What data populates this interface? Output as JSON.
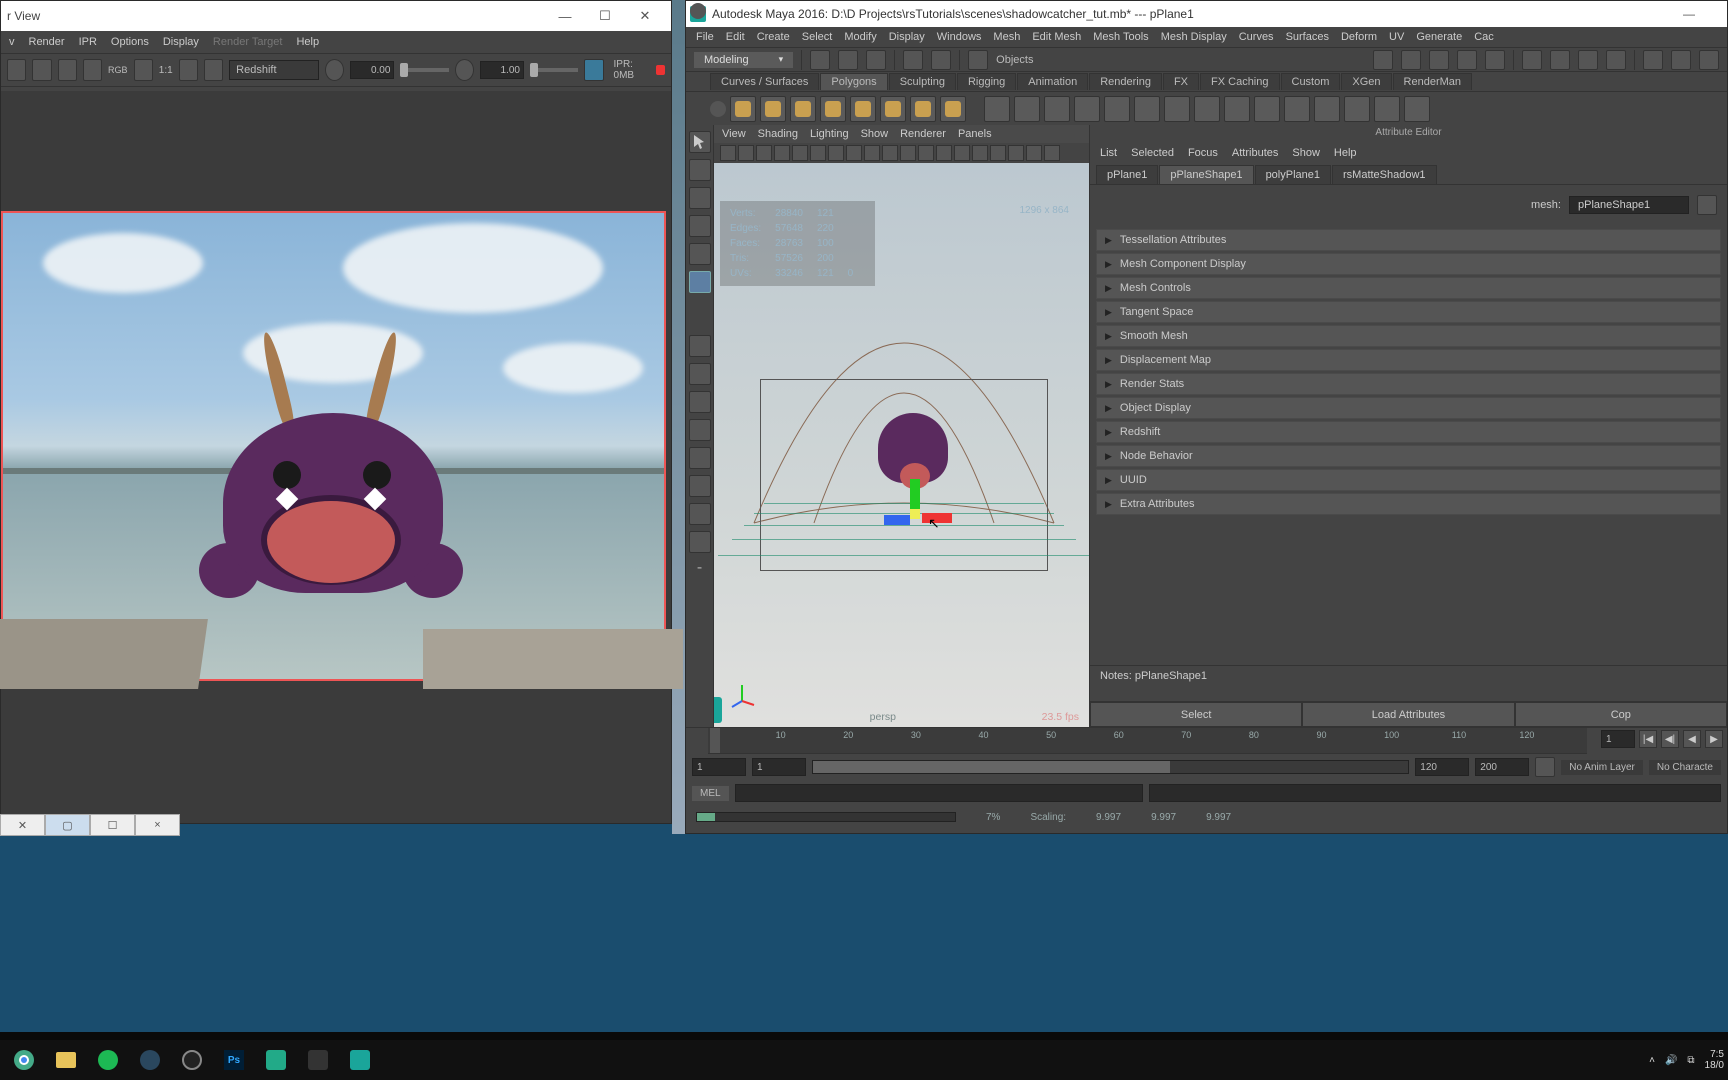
{
  "render_view": {
    "title": "r View",
    "menus": [
      "v",
      "Render",
      "IPR",
      "Options",
      "Display",
      "Render Target",
      "Help"
    ],
    "renderer": "Redshift",
    "ratio": "1:1",
    "rgb": "RGB",
    "exposure_a": "0.00",
    "exposure_b": "1.00",
    "ipr_label": "IPR: 0MB",
    "tab_close": "×"
  },
  "maya": {
    "title": "Autodesk Maya 2016: D:\\D Projects\\rsTutorials\\scenes\\shadowcatcher_tut.mb*  ---  pPlane1",
    "min": "—",
    "menus": [
      "File",
      "Edit",
      "Create",
      "Select",
      "Modify",
      "Display",
      "Windows",
      "Mesh",
      "Edit Mesh",
      "Mesh Tools",
      "Mesh Display",
      "Curves",
      "Surfaces",
      "Deform",
      "UV",
      "Generate",
      "Cac"
    ],
    "mode": "Modeling",
    "objects": "Objects",
    "shelves": [
      "Curves / Surfaces",
      "Polygons",
      "Sculpting",
      "Rigging",
      "Animation",
      "Rendering",
      "FX",
      "FX Caching",
      "Custom",
      "XGen",
      "RenderMan"
    ],
    "viewport": {
      "menus": [
        "View",
        "Shading",
        "Lighting",
        "Show",
        "Renderer",
        "Panels"
      ],
      "hud_res": "1296 x 864",
      "hud": [
        [
          "Verts:",
          "28840",
          "121",
          ""
        ],
        [
          "Edges:",
          "57648",
          "220",
          ""
        ],
        [
          "Faces:",
          "28763",
          "100",
          ""
        ],
        [
          "Tris:",
          "57526",
          "200",
          ""
        ],
        [
          "UVs:",
          "33246",
          "121",
          "0"
        ]
      ],
      "camera": "persp",
      "fps": "23.5 fps"
    },
    "attr": {
      "title": "Attribute Editor",
      "menus": [
        "List",
        "Selected",
        "Focus",
        "Attributes",
        "Show",
        "Help"
      ],
      "tabs": [
        "pPlane1",
        "pPlaneShape1",
        "polyPlane1",
        "rsMatteShadow1"
      ],
      "active_tab": 1,
      "mesh_label": "mesh:",
      "mesh_value": "pPlaneShape1",
      "sections": [
        "Tessellation Attributes",
        "Mesh Component Display",
        "Mesh Controls",
        "Tangent Space",
        "Smooth Mesh",
        "Displacement Map",
        "Render Stats",
        "Object Display",
        "Redshift",
        "Node Behavior",
        "UUID",
        "Extra Attributes"
      ],
      "notes_label": "Notes: pPlaneShape1",
      "buttons": [
        "Select",
        "Load Attributes",
        "Cop"
      ]
    },
    "timeline": {
      "ticks": [
        "10",
        "20",
        "30",
        "40",
        "50",
        "60",
        "70",
        "80",
        "90",
        "100",
        "110",
        "120"
      ],
      "cur_frame": "1",
      "range": {
        "start": "1",
        "vis_start": "1",
        "vis_end": "120",
        "end": "200"
      },
      "anim_layer": "No Anim Layer",
      "char": "No Characte",
      "mel": "MEL",
      "progress": "7%",
      "scaling_label": "Scaling:",
      "scaling": [
        "9.997",
        "9.997",
        "9.997"
      ]
    }
  },
  "systray": {
    "time": "7:5",
    "date": "18/0"
  }
}
